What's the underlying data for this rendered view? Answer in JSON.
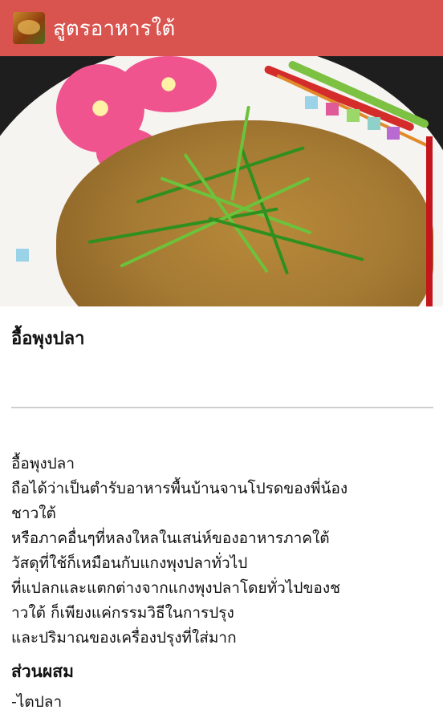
{
  "appbar": {
    "title": "สูตรอาหารใต้",
    "icon": "app-food-icon"
  },
  "hero": {
    "image": "fish-curry-photo"
  },
  "recipe": {
    "title": "อื้อพุงปลา",
    "description_lines": [
      "อื้อพุงปลา",
      "ถือได้ว่าเป็นตำรับอาหารพื้นบ้านจานโปรดของพี่น้อง",
      "ชาวใต้",
      "หรือภาคอื่นๆที่หลงใหลในเสน่ห์ของอาหารภาคใต้",
      "วัสดุที่ใช้ก็เหมือนกับแกงพุงปลาทั่วไป",
      "ที่แปลกและแตกต่างจากแกงพุงปลาโดยทั่วไปของช",
      "าวใต้ ก็เพียงแค่กรรมวิธีในการปรุง",
      "และปริมาณของเครื่องปรุงที่ใส่มาก"
    ],
    "ingredients_title": "ส่วนผสม",
    "ingredients": [
      "-ไตปลา"
    ]
  },
  "colors": {
    "appbar": "#d9534f",
    "accent_red": "#c4161c"
  }
}
